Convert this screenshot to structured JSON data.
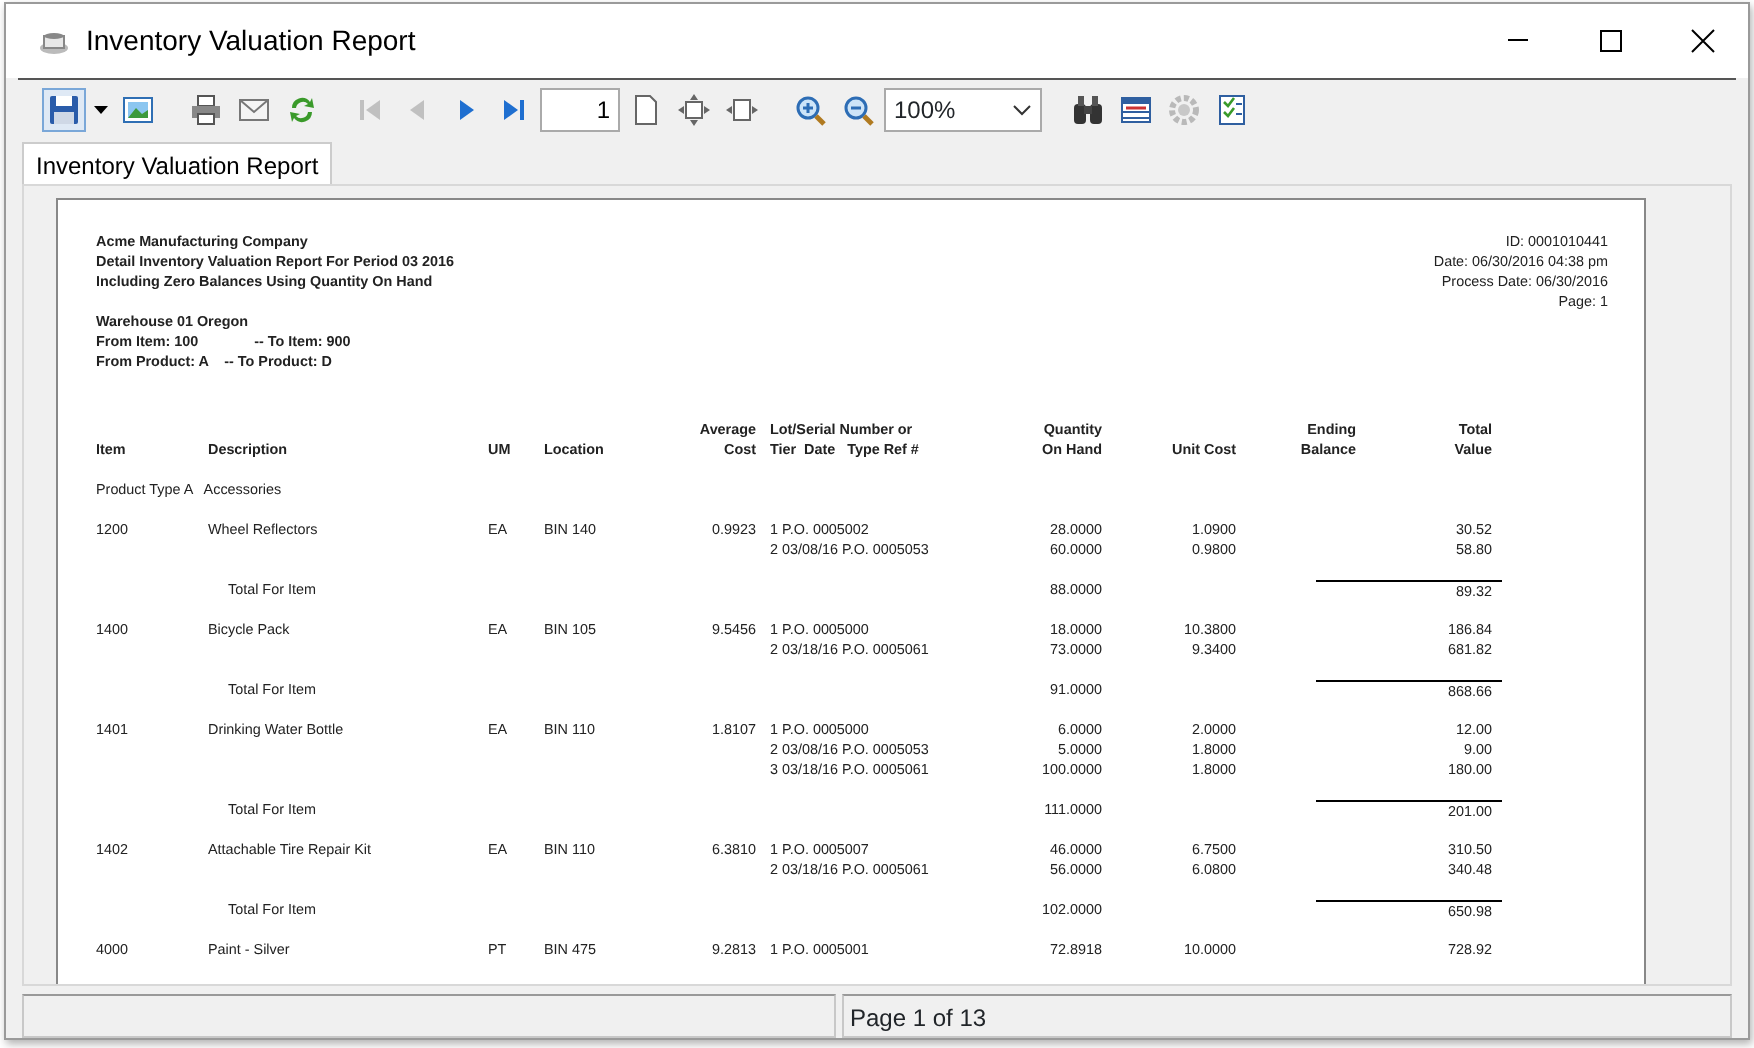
{
  "window": {
    "title": "Inventory Valuation Report"
  },
  "toolbar": [
    [
      {
        "kind": "save",
        "disabled": false
      },
      {
        "kind": "dropdown",
        "disabled": false
      },
      {
        "kind": "export-image",
        "disabled": false
      }
    ],
    [
      {
        "kind": "print",
        "disabled": false
      },
      {
        "kind": "email",
        "disabled": false
      },
      {
        "kind": "refresh",
        "disabled": false
      }
    ],
    [
      {
        "kind": "first",
        "disabled": true
      },
      {
        "kind": "previous",
        "disabled": true
      },
      {
        "kind": "next",
        "disabled": false
      },
      {
        "kind": "last",
        "disabled": false
      },
      {
        "kind": "page-field",
        "value": "1"
      },
      {
        "kind": "page-setup",
        "disabled": false
      },
      {
        "kind": "fit-page",
        "disabled": false
      },
      {
        "kind": "fit-width",
        "disabled": false
      }
    ],
    [
      {
        "kind": "zoom-in",
        "disabled": false
      },
      {
        "kind": "zoom-out",
        "disabled": false
      },
      {
        "kind": "zoom-select",
        "value": "100%"
      }
    ],
    [
      {
        "kind": "find",
        "disabled": false
      },
      {
        "kind": "table",
        "disabled": false
      },
      {
        "kind": "settings",
        "disabled": true
      },
      {
        "kind": "checklist",
        "disabled": false
      }
    ]
  ],
  "tabs": [
    {
      "label": "Inventory Valuation Report",
      "selected": true
    }
  ],
  "report": {
    "title_lines": [
      "Acme Manufacturing Company",
      "Detail Inventory Valuation Report For Period 03 2016",
      "Including Zero Balances Using Quantity On Hand"
    ],
    "info_lines": [
      "ID: 0001010441",
      "Date: 06/30/2016 04:38 pm",
      "Process Date: 06/30/2016",
      "Page: 1"
    ],
    "filter_lines": [
      "Warehouse 01 Oregon",
      "From Item: 100              -- To Item: 900",
      "From Product: A    -- To Product: D"
    ],
    "columns": [
      {
        "bottom": "Item"
      },
      {
        "bottom": "Description"
      },
      {
        "bottom": "UM"
      },
      {
        "bottom": "Location"
      },
      {
        "top": "Average",
        "bottom": "Cost"
      },
      {
        "top": "Lot/Serial Number or",
        "bottom": "Tier  Date   Type Ref #"
      },
      {
        "top": "Quantity",
        "bottom": "On Hand"
      },
      {
        "bottom": "Unit Cost"
      },
      {
        "top": "Ending",
        "bottom": "Balance"
      },
      {
        "top": "Total",
        "bottom": "Value"
      }
    ],
    "group": "Product Type A   Accessories",
    "items": [
      {
        "item": "1200",
        "description": "Wheel Reflectors",
        "um": "EA",
        "location": "BIN 140",
        "average_cost": "0.9923",
        "lots": [
          {
            "lot": "1 P.O. 0005002",
            "quantity": "28.0000",
            "unit_cost": "1.0900",
            "value": "30.52"
          },
          {
            "lot": "2 03/08/16 P.O. 0005053",
            "quantity": "60.0000",
            "unit_cost": "0.9800",
            "value": "58.80"
          }
        ],
        "total": {
          "label": "Total For Item",
          "quantity": "88.0000",
          "value": "89.32"
        }
      },
      {
        "item": "1400",
        "description": "Bicycle Pack",
        "um": "EA",
        "location": "BIN 105",
        "average_cost": "9.5456",
        "lots": [
          {
            "lot": "1 P.O. 0005000",
            "quantity": "18.0000",
            "unit_cost": "10.3800",
            "value": "186.84"
          },
          {
            "lot": "2 03/18/16 P.O. 0005061",
            "quantity": "73.0000",
            "unit_cost": "9.3400",
            "value": "681.82"
          }
        ],
        "total": {
          "label": "Total For Item",
          "quantity": "91.0000",
          "value": "868.66"
        }
      },
      {
        "item": "1401",
        "description": "Drinking Water Bottle",
        "um": "EA",
        "location": "BIN 110",
        "average_cost": "1.8107",
        "lots": [
          {
            "lot": "1 P.O. 0005000",
            "quantity": "6.0000",
            "unit_cost": "2.0000",
            "value": "12.00"
          },
          {
            "lot": "2 03/08/16 P.O. 0005053",
            "quantity": "5.0000",
            "unit_cost": "1.8000",
            "value": "9.00"
          },
          {
            "lot": "3 03/18/16 P.O. 0005061",
            "quantity": "100.0000",
            "unit_cost": "1.8000",
            "value": "180.00"
          }
        ],
        "total": {
          "label": "Total For Item",
          "quantity": "111.0000",
          "value": "201.00"
        }
      },
      {
        "item": "1402",
        "description": "Attachable Tire Repair Kit",
        "um": "EA",
        "location": "BIN 110",
        "average_cost": "6.3810",
        "lots": [
          {
            "lot": "1 P.O. 0005007",
            "quantity": "46.0000",
            "unit_cost": "6.7500",
            "value": "310.50"
          },
          {
            "lot": "2 03/18/16 P.O. 0005061",
            "quantity": "56.0000",
            "unit_cost": "6.0800",
            "value": "340.48"
          }
        ],
        "total": {
          "label": "Total For Item",
          "quantity": "102.0000",
          "value": "650.98"
        }
      },
      {
        "item": "4000",
        "description": "Paint - Silver",
        "um": "PT",
        "location": "BIN 475",
        "average_cost": "9.2813",
        "lots": [
          {
            "lot": "1 P.O. 0005001",
            "quantity": "72.8918",
            "unit_cost": "10.0000",
            "value": "728.92"
          }
        ]
      }
    ]
  },
  "status_bar": {
    "page": "Page 1 of 13"
  }
}
